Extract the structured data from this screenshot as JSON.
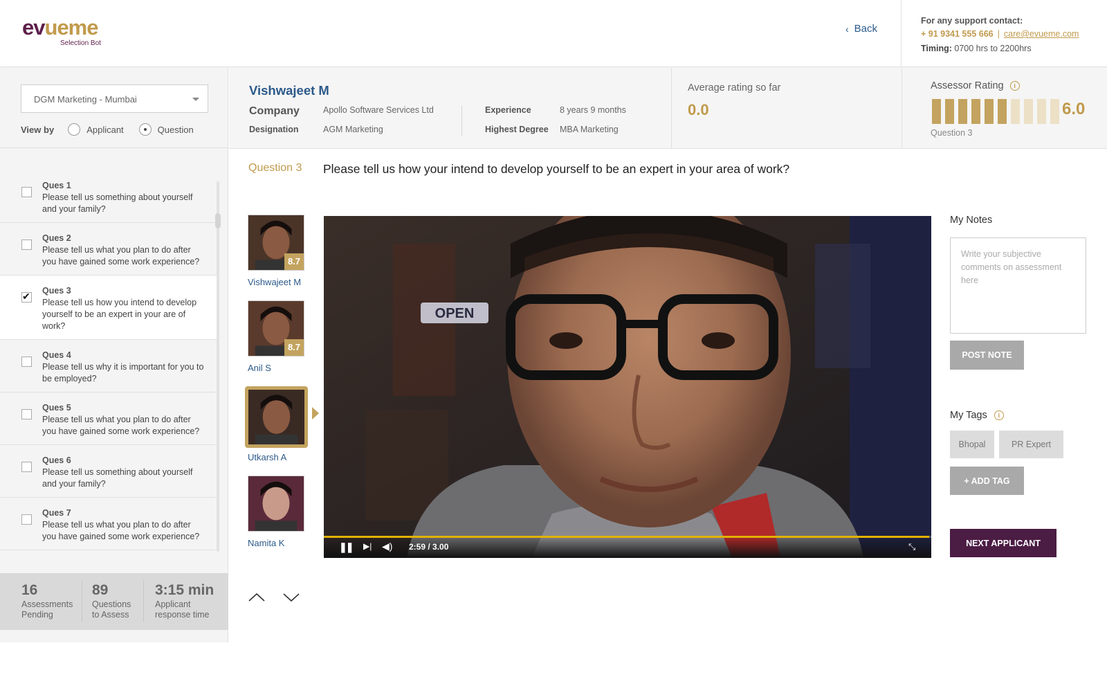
{
  "header": {
    "logo_text": "evueme",
    "logo_sub": "Selection Bot",
    "back_label": "Back",
    "support_label": "For any support contact:",
    "phone": "+ 91 9341 555 666",
    "separator": "|",
    "email": "care@evueme.com",
    "timing_label": "Timing:",
    "timing_value": "0700 hrs to  2200hrs"
  },
  "left_panel": {
    "job_select": "DGM Marketing - Mumbai",
    "view_by_label": "View by",
    "view_options": [
      "Applicant",
      "Question"
    ],
    "selected_view": "Question",
    "questions": [
      {
        "num": "Ques 1",
        "text": "Please tell us something about yourself and your family?",
        "checked": false,
        "active": false
      },
      {
        "num": "Ques 2",
        "text": "Please tell us what you plan to do after you have gained some work experience?",
        "checked": false,
        "active": false
      },
      {
        "num": "Ques 3",
        "text": "Please tell us how you intend to develop yourself to be an expert in your are of work?",
        "checked": true,
        "active": true
      },
      {
        "num": "Ques 4",
        "text": "Please tell us why it is important for you to be employed?",
        "checked": false,
        "active": false
      },
      {
        "num": "Ques 5",
        "text": "Please tell us what you plan to do after you have gained some work experience?",
        "checked": false,
        "active": false
      },
      {
        "num": "Ques 6",
        "text": "Please tell us something about yourself and your family?",
        "checked": false,
        "active": false
      },
      {
        "num": "Ques 7",
        "text": "Please tell us what you plan to do after you have gained some work experience?",
        "checked": false,
        "active": false
      }
    ],
    "stats": [
      {
        "num": "16",
        "label1": "Assessments",
        "label2": "Pending"
      },
      {
        "num": "89",
        "label1": "Questions",
        "label2": "to Assess"
      },
      {
        "num": "3:15 min",
        "label1": "Applicant",
        "label2": "response time"
      }
    ]
  },
  "candidate": {
    "name": "Vishwajeet M",
    "company_label": "Company",
    "company": "Apollo Software Services Ltd",
    "designation_label": "Designation",
    "designation": "AGM Marketing",
    "experience_label": "Experience",
    "experience": "8 years 9 months",
    "degree_label": "Highest Degree",
    "degree": "MBA Marketing",
    "avg_label": "Average rating so far",
    "avg_value": "0.0",
    "assessor_label": "Assessor Rating",
    "assessor_value": "6.0",
    "assessor_bars_filled": 6,
    "assessor_bars_total": 10,
    "assessor_question": "Question 3"
  },
  "question": {
    "label": "Question 3",
    "text": "Please tell us how your intend to develop yourself to be an expert in your area of work?"
  },
  "applicants": [
    {
      "name": "Vishwajeet M",
      "score": "8.7",
      "active": false
    },
    {
      "name": "Anil S",
      "score": "8.7",
      "active": false
    },
    {
      "name": "Utkarsh A",
      "score": "",
      "active": true
    },
    {
      "name": "Namita K",
      "score": "",
      "active": false
    }
  ],
  "video": {
    "time": "2:59 / 3.00",
    "progress": 0.997,
    "overlay_text": "OPEN"
  },
  "notes": {
    "title": "My Notes",
    "placeholder": "Write your subjective comments on assessment here",
    "post_label": "POST NOTE"
  },
  "tags": {
    "title": "My Tags",
    "items": [
      "Bhopal",
      "PR Expert"
    ],
    "add_label": "+ ADD TAG"
  },
  "next_label": "NEXT APPLICANT",
  "colors": {
    "gold": "#c19a4c",
    "blue": "#2c5a8a",
    "plum": "#4b1c44"
  }
}
